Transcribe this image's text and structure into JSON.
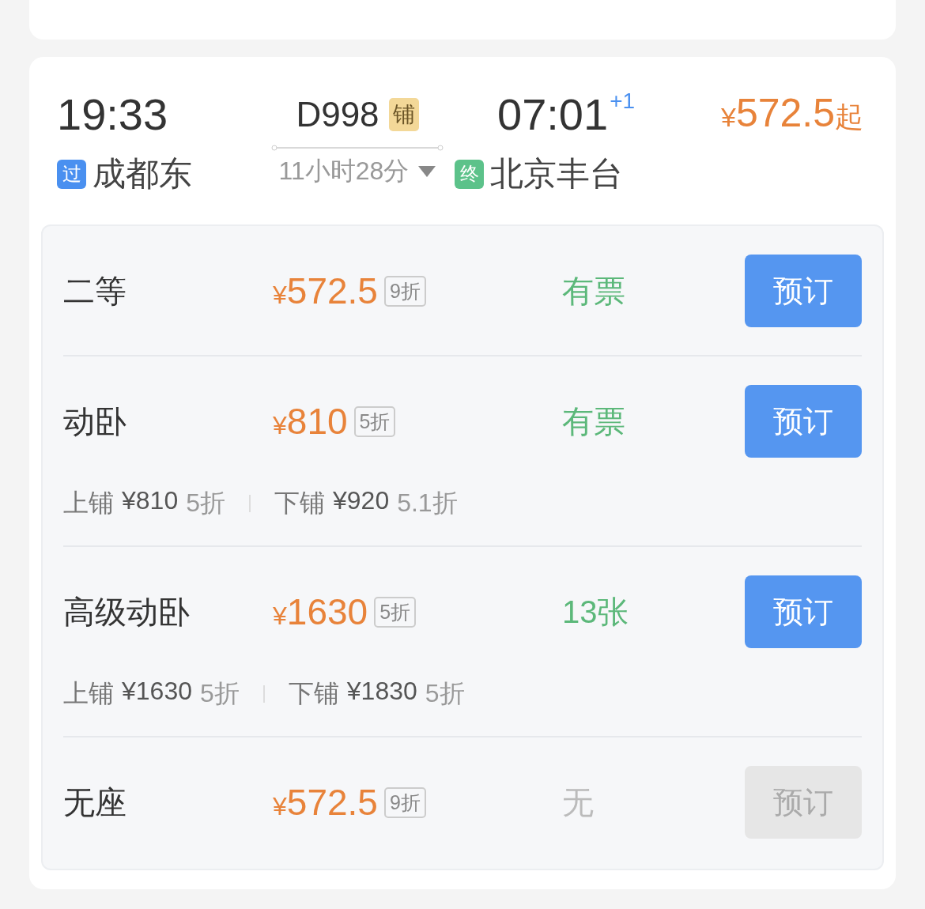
{
  "train": {
    "depart_time": "19:33",
    "depart_badge": "过",
    "depart_station": "成都东",
    "number": "D998",
    "berth_tag": "铺",
    "duration": "11小时28分",
    "arrive_time": "07:01",
    "day_offset": "+1",
    "arrive_badge": "终",
    "arrive_station": "北京丰台",
    "price_symbol": "¥",
    "price": "572.5",
    "price_suffix": "起"
  },
  "seats": [
    {
      "name": "二等",
      "price_symbol": "¥",
      "price": "572.5",
      "discount": "9折",
      "availability": "有票",
      "available": true,
      "button": "预订",
      "disabled": false
    },
    {
      "name": "动卧",
      "price_symbol": "¥",
      "price": "810",
      "discount": "5折",
      "availability": "有票",
      "available": true,
      "button": "预订",
      "disabled": false,
      "berths": [
        {
          "label": "上铺",
          "price": "¥810",
          "discount": "5折"
        },
        {
          "label": "下铺",
          "price": "¥920",
          "discount": "5.1折"
        }
      ]
    },
    {
      "name": "高级动卧",
      "price_symbol": "¥",
      "price": "1630",
      "discount": "5折",
      "availability": "13张",
      "available": true,
      "button": "预订",
      "disabled": false,
      "berths": [
        {
          "label": "上铺",
          "price": "¥1630",
          "discount": "5折"
        },
        {
          "label": "下铺",
          "price": "¥1830",
          "discount": "5折"
        }
      ]
    },
    {
      "name": "无座",
      "price_symbol": "¥",
      "price": "572.5",
      "discount": "9折",
      "availability": "无",
      "available": false,
      "button": "预订",
      "disabled": true
    }
  ]
}
